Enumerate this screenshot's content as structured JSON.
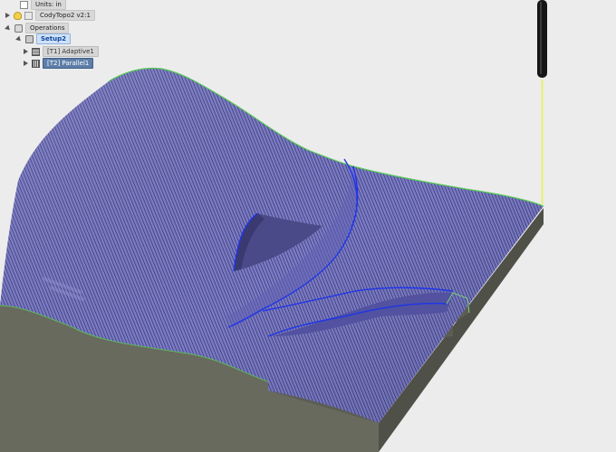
{
  "browser": {
    "units_label": "Units: in",
    "component_label": "CodyTopo2 v2:1",
    "operations_label": "Operations",
    "setup_label": "Setup2",
    "operations": [
      {
        "label": "[T1] Adaptive1",
        "selected": false
      },
      {
        "label": "[T2] Parallel1",
        "selected": true
      }
    ]
  },
  "colors": {
    "background": "#ececec",
    "toolpath_surface": "#7a7ac8",
    "toolpath_line": "#2a2a5a",
    "stock_side": "#6e6e62",
    "stock_front": "#5f5f54",
    "tool_shank": "#151515",
    "tool_trace": "#e6f07a",
    "highlight_path": "#1e35e8",
    "edge_green": "#58c858"
  },
  "icons": {
    "units": "document-icon",
    "component": "lightbulb-icon",
    "operations": "operations-folder-icon",
    "setup": "setup-icon",
    "adaptive": "adaptive-toolpath-icon",
    "parallel": "parallel-toolpath-icon",
    "tool": "cutting-tool-icon"
  }
}
